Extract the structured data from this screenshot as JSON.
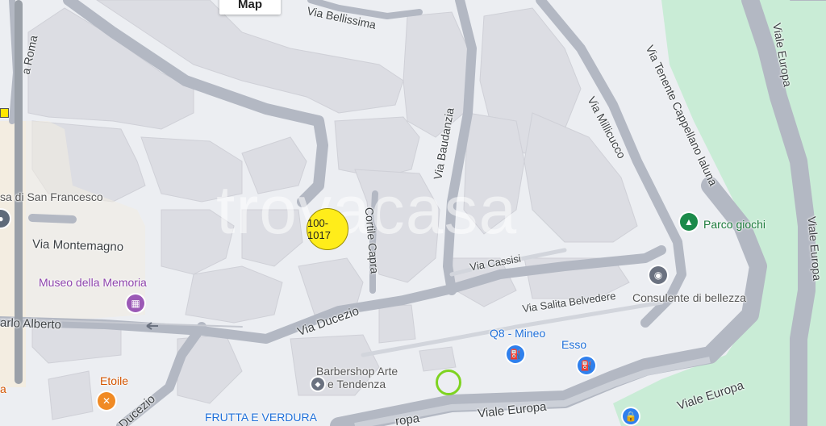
{
  "map": {
    "tab_label": "Map",
    "watermark": "trovacasa",
    "marker_label": "100-1017",
    "streets": {
      "via_bellissima": "Via Bellissima",
      "via_baudanzia": "Via Baudanzia",
      "via_millicucco": "Via Millicucco",
      "via_tenente": "Via Tenente Cappellano Ialuna",
      "viale_europa_right": "Viale Europa",
      "viale_europa_top": "Viale Europa",
      "viale_europa_bottom1": "Viale Europa",
      "viale_europa_bottom2": "Viale Europa",
      "europa_left": "ropa",
      "cortile_capra": "Cortile Capra",
      "via_cassisi": "Via Cassisi",
      "via_salita": "Via Salita Belvedere",
      "via_ducezio": "Via Ducezio",
      "ducezio_low": "Ducezio",
      "via_montemagno": "Via Montemagno",
      "carlo_alberto": "arlo Alberto",
      "via_roma": "a Roma"
    },
    "pois": {
      "san_francesco": "sa di San Francesco",
      "museo": "Museo della Memoria",
      "parco": "Parco giochi",
      "consulente": "Consulente di bellezza",
      "q8": "Q8 - Mineo",
      "esso": "Esso",
      "barbershop_line1": "Barbershop Arte",
      "barbershop_line2": "e Tendenza",
      "etoile": "Etoile",
      "frutta": "FRUTTA E VERDURA",
      "left_edge": "a"
    }
  }
}
